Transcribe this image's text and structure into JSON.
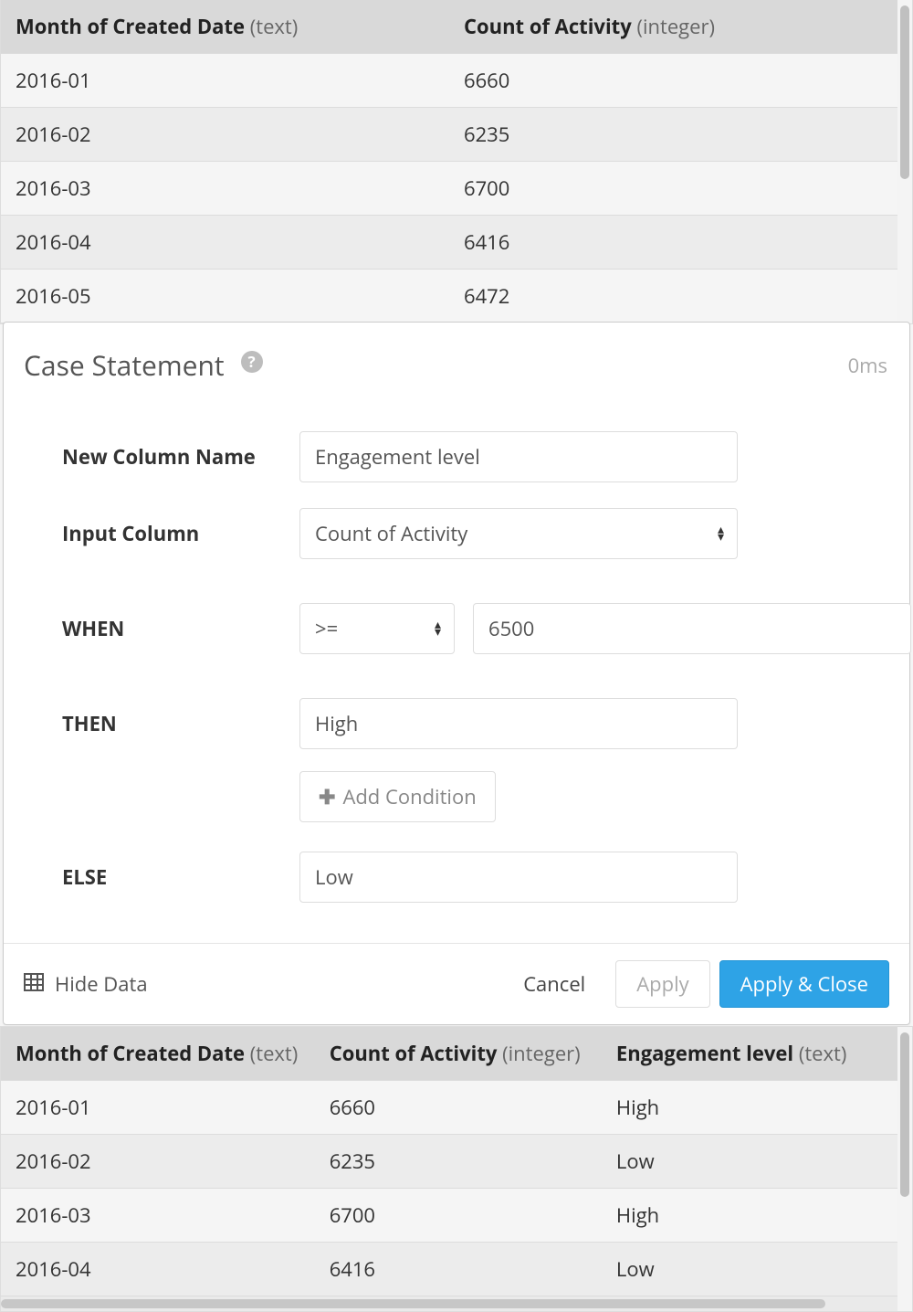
{
  "top_table": {
    "columns": [
      {
        "name": "Month of Created Date",
        "type": "(text)"
      },
      {
        "name": "Count of Activity",
        "type": "(integer)"
      }
    ],
    "rows": [
      {
        "month": "2016-01",
        "count": "6660"
      },
      {
        "month": "2016-02",
        "count": "6235"
      },
      {
        "month": "2016-03",
        "count": "6700"
      },
      {
        "month": "2016-04",
        "count": "6416"
      }
    ],
    "cut_row": {
      "month": "2016-05",
      "count": "6472"
    }
  },
  "panel": {
    "title": "Case Statement",
    "timing": "0ms",
    "labels": {
      "new_column": "New Column Name",
      "input_column": "Input Column",
      "when": "WHEN",
      "then": "THEN",
      "else": "ELSE"
    },
    "values": {
      "new_column": "Engagement level",
      "input_column": "Count of Activity",
      "when_op": ">=",
      "when_val": "6500",
      "then": "High",
      "else": "Low"
    },
    "add_condition": "Add Condition",
    "footer": {
      "hide_data": "Hide Data",
      "cancel": "Cancel",
      "apply": "Apply",
      "apply_close": "Apply & Close"
    }
  },
  "bottom_table": {
    "columns": [
      {
        "name": "Month of Created Date",
        "type": "(text)"
      },
      {
        "name": "Count of Activity",
        "type": "(integer)"
      },
      {
        "name": "Engagement level",
        "type": "(text)"
      }
    ],
    "rows": [
      {
        "month": "2016-01",
        "count": "6660",
        "level": "High"
      },
      {
        "month": "2016-02",
        "count": "6235",
        "level": "Low"
      },
      {
        "month": "2016-03",
        "count": "6700",
        "level": "High"
      },
      {
        "month": "2016-04",
        "count": "6416",
        "level": "Low"
      }
    ]
  }
}
